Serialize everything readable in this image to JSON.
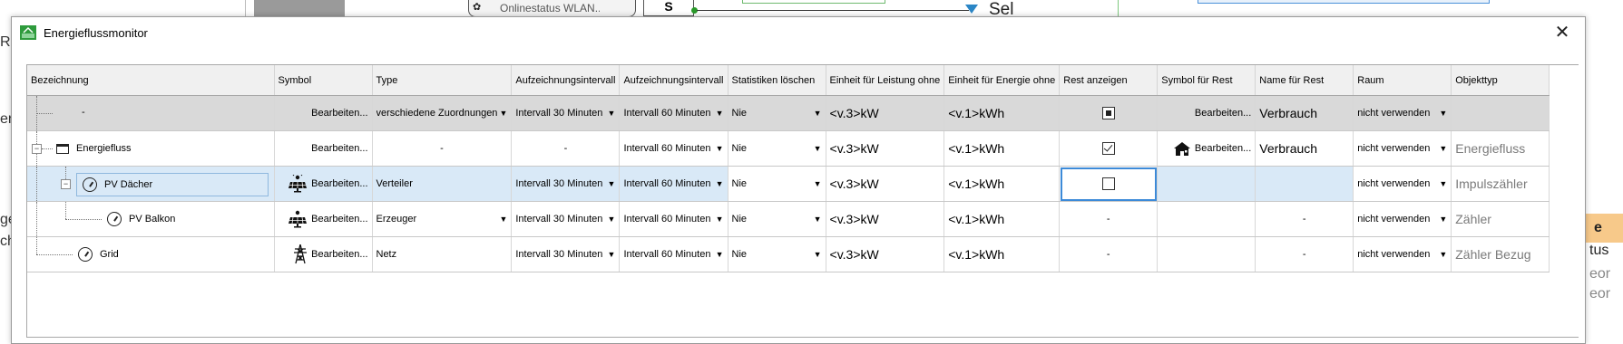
{
  "background": {
    "node_label": "Onlinestatus WLAN...",
    "node_value": "S",
    "sel_text": "Sel",
    "left_texts": [
      "Re",
      "en",
      "ge",
      "ch"
    ],
    "right_badge": "e",
    "right_texts": [
      "tus",
      "eor",
      "eor"
    ]
  },
  "dialog": {
    "title": "Energieflussmonitor",
    "close_label": "✕"
  },
  "columns": [
    "Bezeichnung",
    "Symbol",
    "Type",
    "Aufzeichnungsintervall",
    "Aufzeichnungsintervall",
    "Statistiken löschen",
    "Einheit für Leistung ohne",
    "Einheit für Energie ohne",
    "Rest anzeigen",
    "Symbol für Rest",
    "Name für Rest",
    "Raum",
    "Objekttyp"
  ],
  "rows": [
    {
      "name": "-",
      "symbol": "Bearbeiten...",
      "type": "verschiedene Zuordnungen",
      "interval1": "Intervall 30 Minuten",
      "interval2": "Intervall 60 Minuten",
      "stats": "Nie",
      "unit_power": "<v.3>kW",
      "unit_energy": "<v.1>kWh",
      "rest_state": "indeterminate",
      "rest_symbol": "Bearbeiten...",
      "rest_name": "Verbrauch",
      "room": "nicht verwenden",
      "objtype": ""
    },
    {
      "name": "Energiefluss",
      "symbol": "Bearbeiten...",
      "type": "-",
      "interval1": "-",
      "interval2": "Intervall 60 Minuten",
      "stats": "Nie",
      "unit_power": "<v.3>kW",
      "unit_energy": "<v.1>kWh",
      "rest_state": "checked",
      "rest_symbol": "Bearbeiten...",
      "rest_name": "Verbrauch",
      "room": "nicht verwenden",
      "objtype": "Energiefluss"
    },
    {
      "name": "PV Dächer",
      "symbol": "Bearbeiten...",
      "type": "Verteiler",
      "interval1": "Intervall 30 Minuten",
      "interval2": "Intervall 60 Minuten",
      "stats": "Nie",
      "unit_power": "<v.3>kW",
      "unit_energy": "<v.1>kWh",
      "rest_state": "unchecked",
      "rest_symbol": "",
      "rest_name": "",
      "room": "nicht verwenden",
      "objtype": "Impulszähler"
    },
    {
      "name": "PV Balkon",
      "symbol": "Bearbeiten...",
      "type": "Erzeuger",
      "interval1": "Intervall 30 Minuten",
      "interval2": "Intervall 60 Minuten",
      "stats": "Nie",
      "unit_power": "<v.3>kW",
      "unit_energy": "<v.1>kWh",
      "rest_state": "-",
      "rest_symbol": "",
      "rest_name": "-",
      "room": "nicht verwenden",
      "objtype": "Zähler"
    },
    {
      "name": "Grid",
      "symbol": "Bearbeiten...",
      "type": "Netz",
      "interval1": "Intervall 30 Minuten",
      "interval2": "Intervall 60 Minuten",
      "stats": "Nie",
      "unit_power": "<v.3>kW",
      "unit_energy": "<v.1>kWh",
      "rest_state": "-",
      "rest_symbol": "",
      "rest_name": "-",
      "room": "nicht verwenden",
      "objtype": "Zähler Bezug"
    }
  ],
  "icons": {
    "app": "energy-monitor-icon",
    "solar": "solar-panel-icon",
    "tower": "power-tower-icon",
    "house": "house-icon",
    "gauge": "gauge-icon",
    "window": "window-icon"
  }
}
